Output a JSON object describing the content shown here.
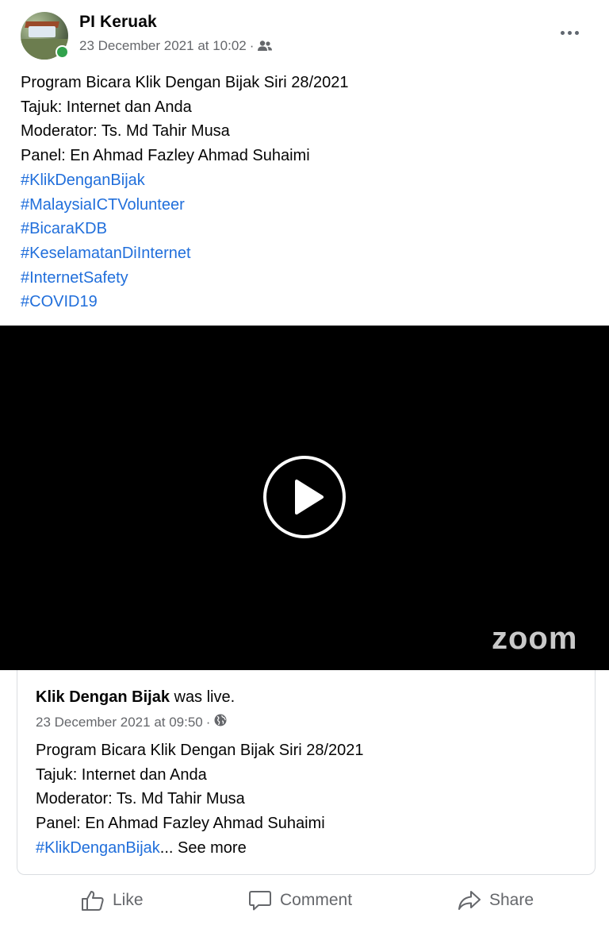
{
  "post": {
    "author": "PI Keruak",
    "timestamp": "23 December 2021 at 10:02",
    "separator": "·",
    "audience_icon": "friends-icon",
    "text_lines": [
      "Program Bicara Klik Dengan Bijak Siri 28/2021",
      "Tajuk: Internet dan Anda",
      "Moderator: Ts. Md Tahir Musa",
      "Panel: En Ahmad Fazley Ahmad Suhaimi"
    ],
    "hashtags": [
      "#KlikDenganBijak",
      "#MalaysiaICTVolunteer",
      "#BicaraKDB",
      "#KeselamatanDiInternet",
      "#InternetSafety",
      "#COVID19"
    ]
  },
  "video": {
    "watermark": "zoom",
    "play_icon": "play-icon"
  },
  "shared": {
    "author": "Klik Dengan Bijak",
    "status": " was live.",
    "timestamp": "23 December 2021 at 09:50",
    "separator": "·",
    "audience_icon": "globe-icon",
    "text_lines": [
      "Program Bicara Klik Dengan Bijak Siri 28/2021",
      "Tajuk: Internet dan Anda",
      "Moderator: Ts. Md Tahir Musa",
      "Panel: En Ahmad Fazley Ahmad Suhaimi"
    ],
    "last_tag": "#KlikDenganBijak",
    "ellipsis": "...",
    "see_more": " See more"
  },
  "actions": {
    "like": "Like",
    "comment": "Comment",
    "share": "Share"
  },
  "colors": {
    "link": "#216fdb",
    "secondary_text": "#65676b",
    "online": "#31a24c"
  }
}
